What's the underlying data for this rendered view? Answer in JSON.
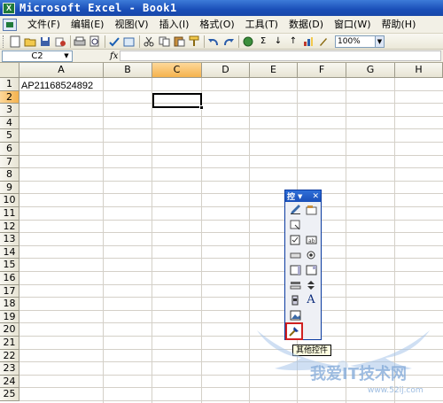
{
  "window": {
    "title": "Microsoft Excel - Book1",
    "app_icon": "X"
  },
  "menu": {
    "items": [
      "文件(F)",
      "编辑(E)",
      "视图(V)",
      "插入(I)",
      "格式(O)",
      "工具(T)",
      "数据(D)",
      "窗口(W)",
      "帮助(H)"
    ]
  },
  "toolbar": {
    "icons": [
      "new-icon",
      "open-icon",
      "save-icon",
      "permission-icon",
      "print-icon",
      "print-preview-icon",
      "spelling-icon",
      "research-icon",
      "cut-icon",
      "copy-icon",
      "paste-icon",
      "format-painter-icon",
      "undo-icon",
      "redo-icon",
      "hyperlink-icon",
      "autosum-icon",
      "sort-ascending-icon",
      "sort-descending-icon",
      "chart-wizard-icon",
      "drawing-icon"
    ],
    "zoom": "100%"
  },
  "formula_bar": {
    "name_box": "C2",
    "fx": "fx",
    "value": ""
  },
  "sheet": {
    "columns": [
      "A",
      "B",
      "C",
      "D",
      "E",
      "F",
      "G",
      "H"
    ],
    "rows": [
      "1",
      "2",
      "3",
      "4",
      "5",
      "6",
      "7",
      "8",
      "9",
      "10",
      "11",
      "12",
      "13",
      "14",
      "15",
      "16",
      "17",
      "18",
      "19",
      "20",
      "21",
      "22",
      "23",
      "24",
      "25"
    ],
    "active_cell": "C2",
    "cells": {
      "A1": "AP21168524892"
    }
  },
  "control_toolbox": {
    "title": "控",
    "tools": [
      "design-mode-icon",
      "properties-icon",
      "view-code-icon",
      "checkbox-icon",
      "textbox-icon",
      "command-button-icon",
      "option-button-icon",
      "listbox-icon",
      "combobox-icon",
      "toggle-button-icon",
      "spin-button-icon",
      "scrollbar-icon",
      "label-icon",
      "image-icon",
      "more-controls-icon"
    ],
    "label_glyph": "A",
    "tooltip": "其他控件"
  },
  "watermark": {
    "text": "我爱IT技术网",
    "url": "www.52ij.com"
  }
}
